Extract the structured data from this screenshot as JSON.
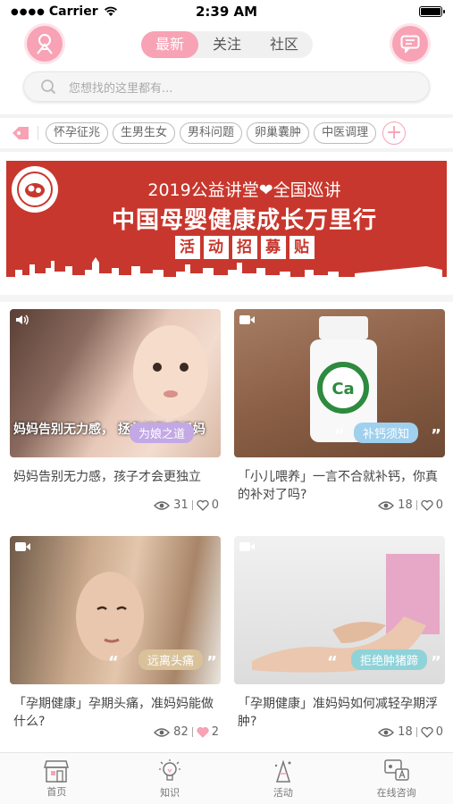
{
  "status_bar": {
    "carrier": "Carrier",
    "time": "2:39 AM"
  },
  "header": {
    "tabs": [
      {
        "label": "最新",
        "active": true
      },
      {
        "label": "关注",
        "active": false
      },
      {
        "label": "社区",
        "active": false
      }
    ]
  },
  "search": {
    "placeholder": "您想找的这里都有..."
  },
  "tags": [
    "怀孕征兆",
    "生男生女",
    "男科问题",
    "卵巢囊肿",
    "中医调理"
  ],
  "banner": {
    "line1": "2019公益讲堂❤全国巡讲",
    "line2": "中国母婴健康成长万里行",
    "line3": [
      "活",
      "动",
      "招",
      "募",
      "贴"
    ]
  },
  "cards": [
    {
      "media": "audio",
      "caption": "为娘之道",
      "caption_color": "purple",
      "title": "妈妈告别无力感，孩子才会更独立",
      "views": "31",
      "likes": "0",
      "overlay_text": "妈妈告别无力感，  拯救控败感妈妈"
    },
    {
      "media": "video",
      "caption": "补钙须知",
      "caption_color": "blue",
      "title": "「小儿喂养」一言不合就补钙，你真的补对了吗?",
      "views": "18",
      "likes": "0",
      "overlay_text": "Ca"
    },
    {
      "media": "video",
      "caption": "远离头痛",
      "caption_color": "gold",
      "title": "「孕期健康」孕期头痛，准妈妈能做什么?",
      "views": "82",
      "likes": "2"
    },
    {
      "media": "video",
      "caption": "拒绝肿猪蹄",
      "caption_color": "teal",
      "title": "「孕期健康」准妈妈如何减轻孕期浮肿?",
      "views": "18",
      "likes": "0"
    }
  ],
  "tab_bar": [
    {
      "label": "首页",
      "icon": "shop-icon"
    },
    {
      "label": "知识",
      "icon": "bulb-icon"
    },
    {
      "label": "活动",
      "icon": "party-icon"
    },
    {
      "label": "在线咨询",
      "icon": "chat-icon"
    }
  ],
  "colors": {
    "accent": "#f7a3b5",
    "banner": "#c8372d"
  }
}
